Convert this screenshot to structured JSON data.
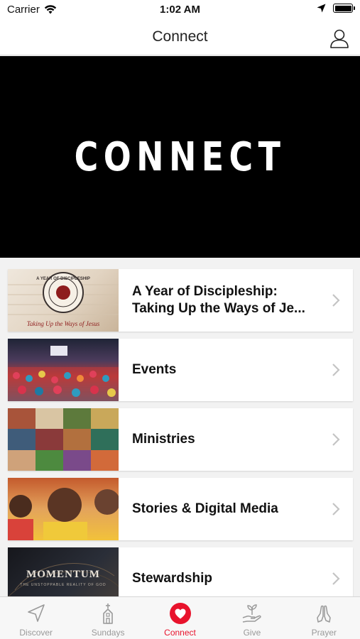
{
  "status_bar": {
    "carrier": "Carrier",
    "time": "1:02 AM"
  },
  "nav": {
    "title": "Connect"
  },
  "hero": {
    "text": "CONNECT"
  },
  "list": [
    {
      "label_line1": "A Year of Discipleship:",
      "label_line2": "Taking Up the Ways of Je...",
      "thumb_title": "A YEAR OF DISCIPLESHIP",
      "thumb_caption": "Taking Up the Ways of Jesus"
    },
    {
      "label": "Events"
    },
    {
      "label": "Ministries"
    },
    {
      "label": "Stories & Digital Media"
    },
    {
      "label": "Stewardship",
      "thumb_title": "MOMENTUM",
      "thumb_caption": "THE UNSTOPPABLE REALITY OF GOD"
    }
  ],
  "tabs": [
    {
      "label": "Discover",
      "icon": "navigation-arrow-icon",
      "active": false
    },
    {
      "label": "Sundays",
      "icon": "church-icon",
      "active": false
    },
    {
      "label": "Connect",
      "icon": "heart-icon",
      "active": true
    },
    {
      "label": "Give",
      "icon": "hand-plant-icon",
      "active": false
    },
    {
      "label": "Prayer",
      "icon": "praying-hands-icon",
      "active": false
    }
  ],
  "colors": {
    "accent": "#e8132c",
    "hero_bg": "#000000",
    "tab_inactive": "#999999"
  }
}
